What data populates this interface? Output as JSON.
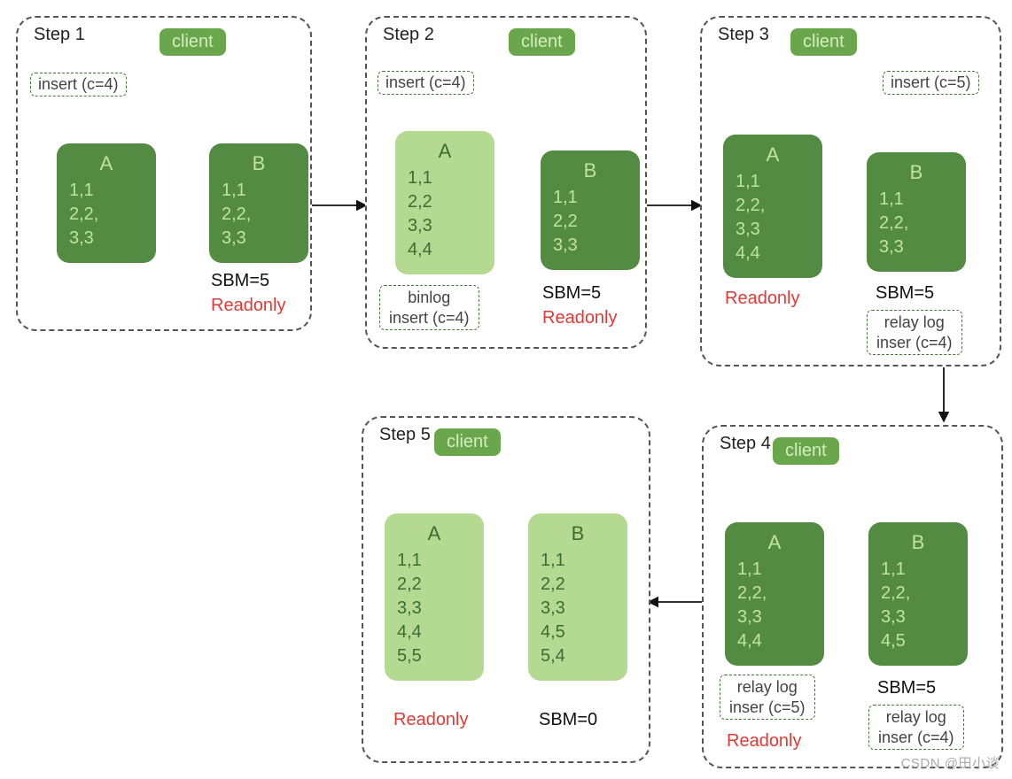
{
  "watermark": "CSDN @田小谈",
  "labels": {
    "client": "client",
    "readonly": "Readonly"
  },
  "steps": {
    "s1": {
      "title": "Step 1",
      "insert": "insert (c=4)",
      "A": {
        "title": "A",
        "rows": "1,1\n2,2,\n3,3"
      },
      "B": {
        "title": "B",
        "rows": "1,1\n2,2,\n3,3"
      },
      "sbm": "SBM=5"
    },
    "s2": {
      "title": "Step 2",
      "insert": "insert (c=4)",
      "A": {
        "title": "A",
        "rows": "1,1\n2,2\n3,3\n4,4"
      },
      "B": {
        "title": "B",
        "rows": "1,1\n2,2\n3,3"
      },
      "binlog": "binlog\ninsert (c=4)",
      "sbm": "SBM=5"
    },
    "s3": {
      "title": "Step 3",
      "insert": "insert (c=5)",
      "A": {
        "title": "A",
        "rows": "1,1\n2,2,\n3,3\n4,4"
      },
      "B": {
        "title": "B",
        "rows": "1,1\n2,2,\n3,3"
      },
      "relay": "relay log\ninser (c=4)",
      "sbm": "SBM=5"
    },
    "s4": {
      "title": "Step 4",
      "A": {
        "title": "A",
        "rows": "1,1\n2,2,\n3,3\n4,4"
      },
      "B": {
        "title": "B",
        "rows": "1,1\n2,2,\n3,3\n4,5"
      },
      "relayA": "relay log\ninser (c=5)",
      "relayB": "relay log\ninser (c=4)",
      "sbm": "SBM=5"
    },
    "s5": {
      "title": "Step 5",
      "A": {
        "title": "A",
        "rows": "1,1\n2,2\n3,3\n4,4\n5,5"
      },
      "B": {
        "title": "B",
        "rows": "1,1\n2,2\n3,3\n4,5\n5,4"
      },
      "sbm": "SBM=0"
    }
  }
}
